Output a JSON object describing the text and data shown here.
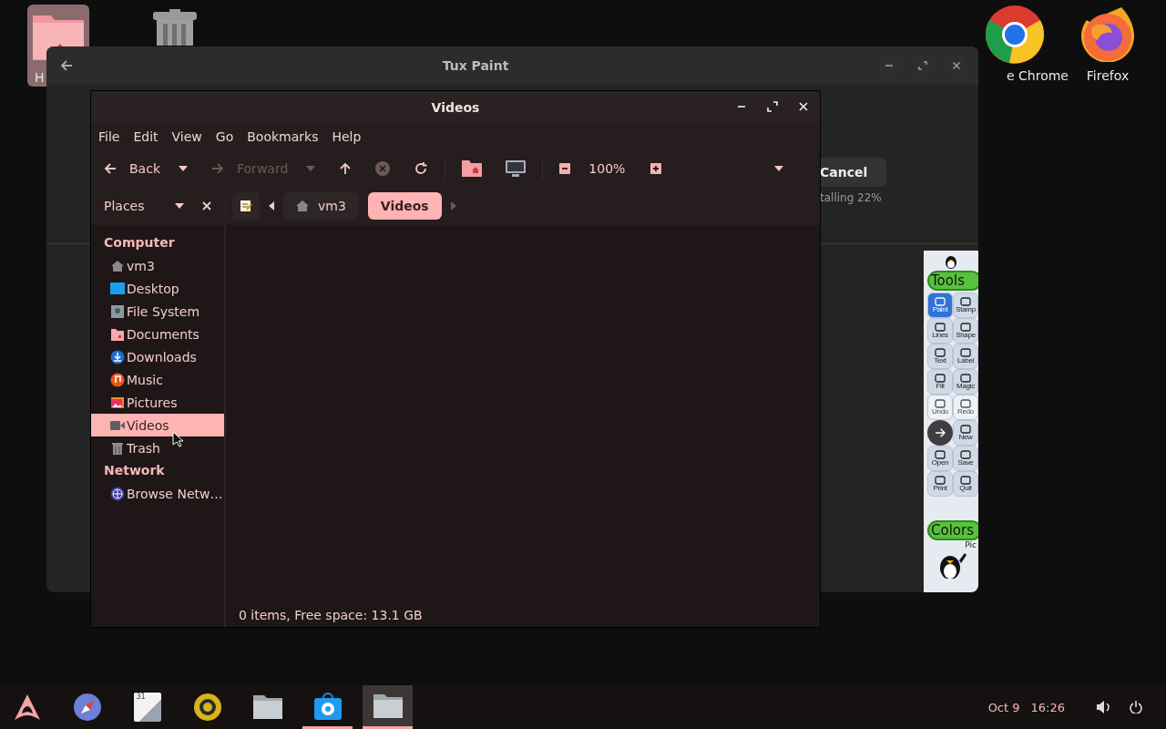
{
  "desktop_icons": [
    {
      "kind": "home",
      "label": "H"
    },
    {
      "kind": "trash"
    },
    {
      "kind": "chrome",
      "label": "e Chrome"
    },
    {
      "kind": "firefox",
      "label": "Firefox"
    }
  ],
  "background_window": {
    "title": "Tux Paint",
    "cancel_button": "Cancel",
    "progress_text": "talling 22%",
    "tuxpaint": {
      "tools_heading": "Tools",
      "tools": [
        {
          "label": "Paint",
          "selected": true,
          "disabled": false
        },
        {
          "label": "Stamp",
          "selected": false,
          "disabled": false
        },
        {
          "label": "Lines",
          "selected": false,
          "disabled": false
        },
        {
          "label": "Shape",
          "selected": false,
          "disabled": false
        },
        {
          "label": "Text",
          "selected": false,
          "disabled": false
        },
        {
          "label": "Label",
          "selected": false,
          "disabled": false
        },
        {
          "label": "Fill",
          "selected": false,
          "disabled": false
        },
        {
          "label": "Magic",
          "selected": false,
          "disabled": false
        },
        {
          "label": "Undo",
          "selected": false,
          "disabled": true
        },
        {
          "label": "Redo",
          "selected": false,
          "disabled": true
        },
        {
          "label": "New",
          "selected": false,
          "disabled": false
        },
        {
          "label": "Open",
          "selected": false,
          "disabled": false
        },
        {
          "label": "Save",
          "selected": false,
          "disabled": false
        },
        {
          "label": "Print",
          "selected": false,
          "disabled": false
        },
        {
          "label": "Quit",
          "selected": false,
          "disabled": false
        }
      ],
      "colors_heading": "Colors",
      "footer_text": "Pic"
    }
  },
  "file_manager": {
    "title": "Videos",
    "menu": [
      "File",
      "Edit",
      "View",
      "Go",
      "Bookmarks",
      "Help"
    ],
    "toolbar": {
      "back": {
        "label": "Back",
        "disabled": false
      },
      "forward": {
        "label": "Forward",
        "disabled": true
      },
      "stop_disabled": true,
      "zoom": "100%"
    },
    "places_label": "Places",
    "path": [
      {
        "kind": "home",
        "label": "vm3",
        "selected": false
      },
      {
        "kind": "folder",
        "label": "Videos",
        "selected": true
      }
    ],
    "sidebar": [
      {
        "heading": "Computer",
        "items": [
          {
            "kind": "home",
            "label": "vm3",
            "selected": false
          },
          {
            "kind": "desktop",
            "label": "Desktop",
            "selected": false
          },
          {
            "kind": "filesystem",
            "label": "File System",
            "selected": false
          },
          {
            "kind": "documents",
            "label": "Documents",
            "selected": false
          },
          {
            "kind": "downloads",
            "label": "Downloads",
            "selected": false
          },
          {
            "kind": "music",
            "label": "Music",
            "selected": false
          },
          {
            "kind": "pictures",
            "label": "Pictures",
            "selected": false
          },
          {
            "kind": "videos",
            "label": "Videos",
            "selected": true
          },
          {
            "kind": "trash",
            "label": "Trash",
            "selected": false
          }
        ]
      },
      {
        "heading": "Network",
        "items": [
          {
            "kind": "network",
            "label": "Browse Netw…",
            "selected": false
          }
        ]
      }
    ],
    "status": "0 items, Free space: 13.1 GB"
  },
  "taskbar": {
    "apps": [
      {
        "kind": "menu",
        "running": false,
        "focused": false
      },
      {
        "kind": "browser",
        "running": false,
        "focused": false
      },
      {
        "kind": "calendar",
        "text": "31",
        "running": false,
        "focused": false
      },
      {
        "kind": "audio",
        "running": false,
        "focused": false
      },
      {
        "kind": "files",
        "running": false,
        "focused": false
      },
      {
        "kind": "store",
        "running": true,
        "focused": false
      },
      {
        "kind": "files",
        "running": true,
        "focused": true
      }
    ],
    "date": "Oct 9",
    "time": "16:26"
  }
}
